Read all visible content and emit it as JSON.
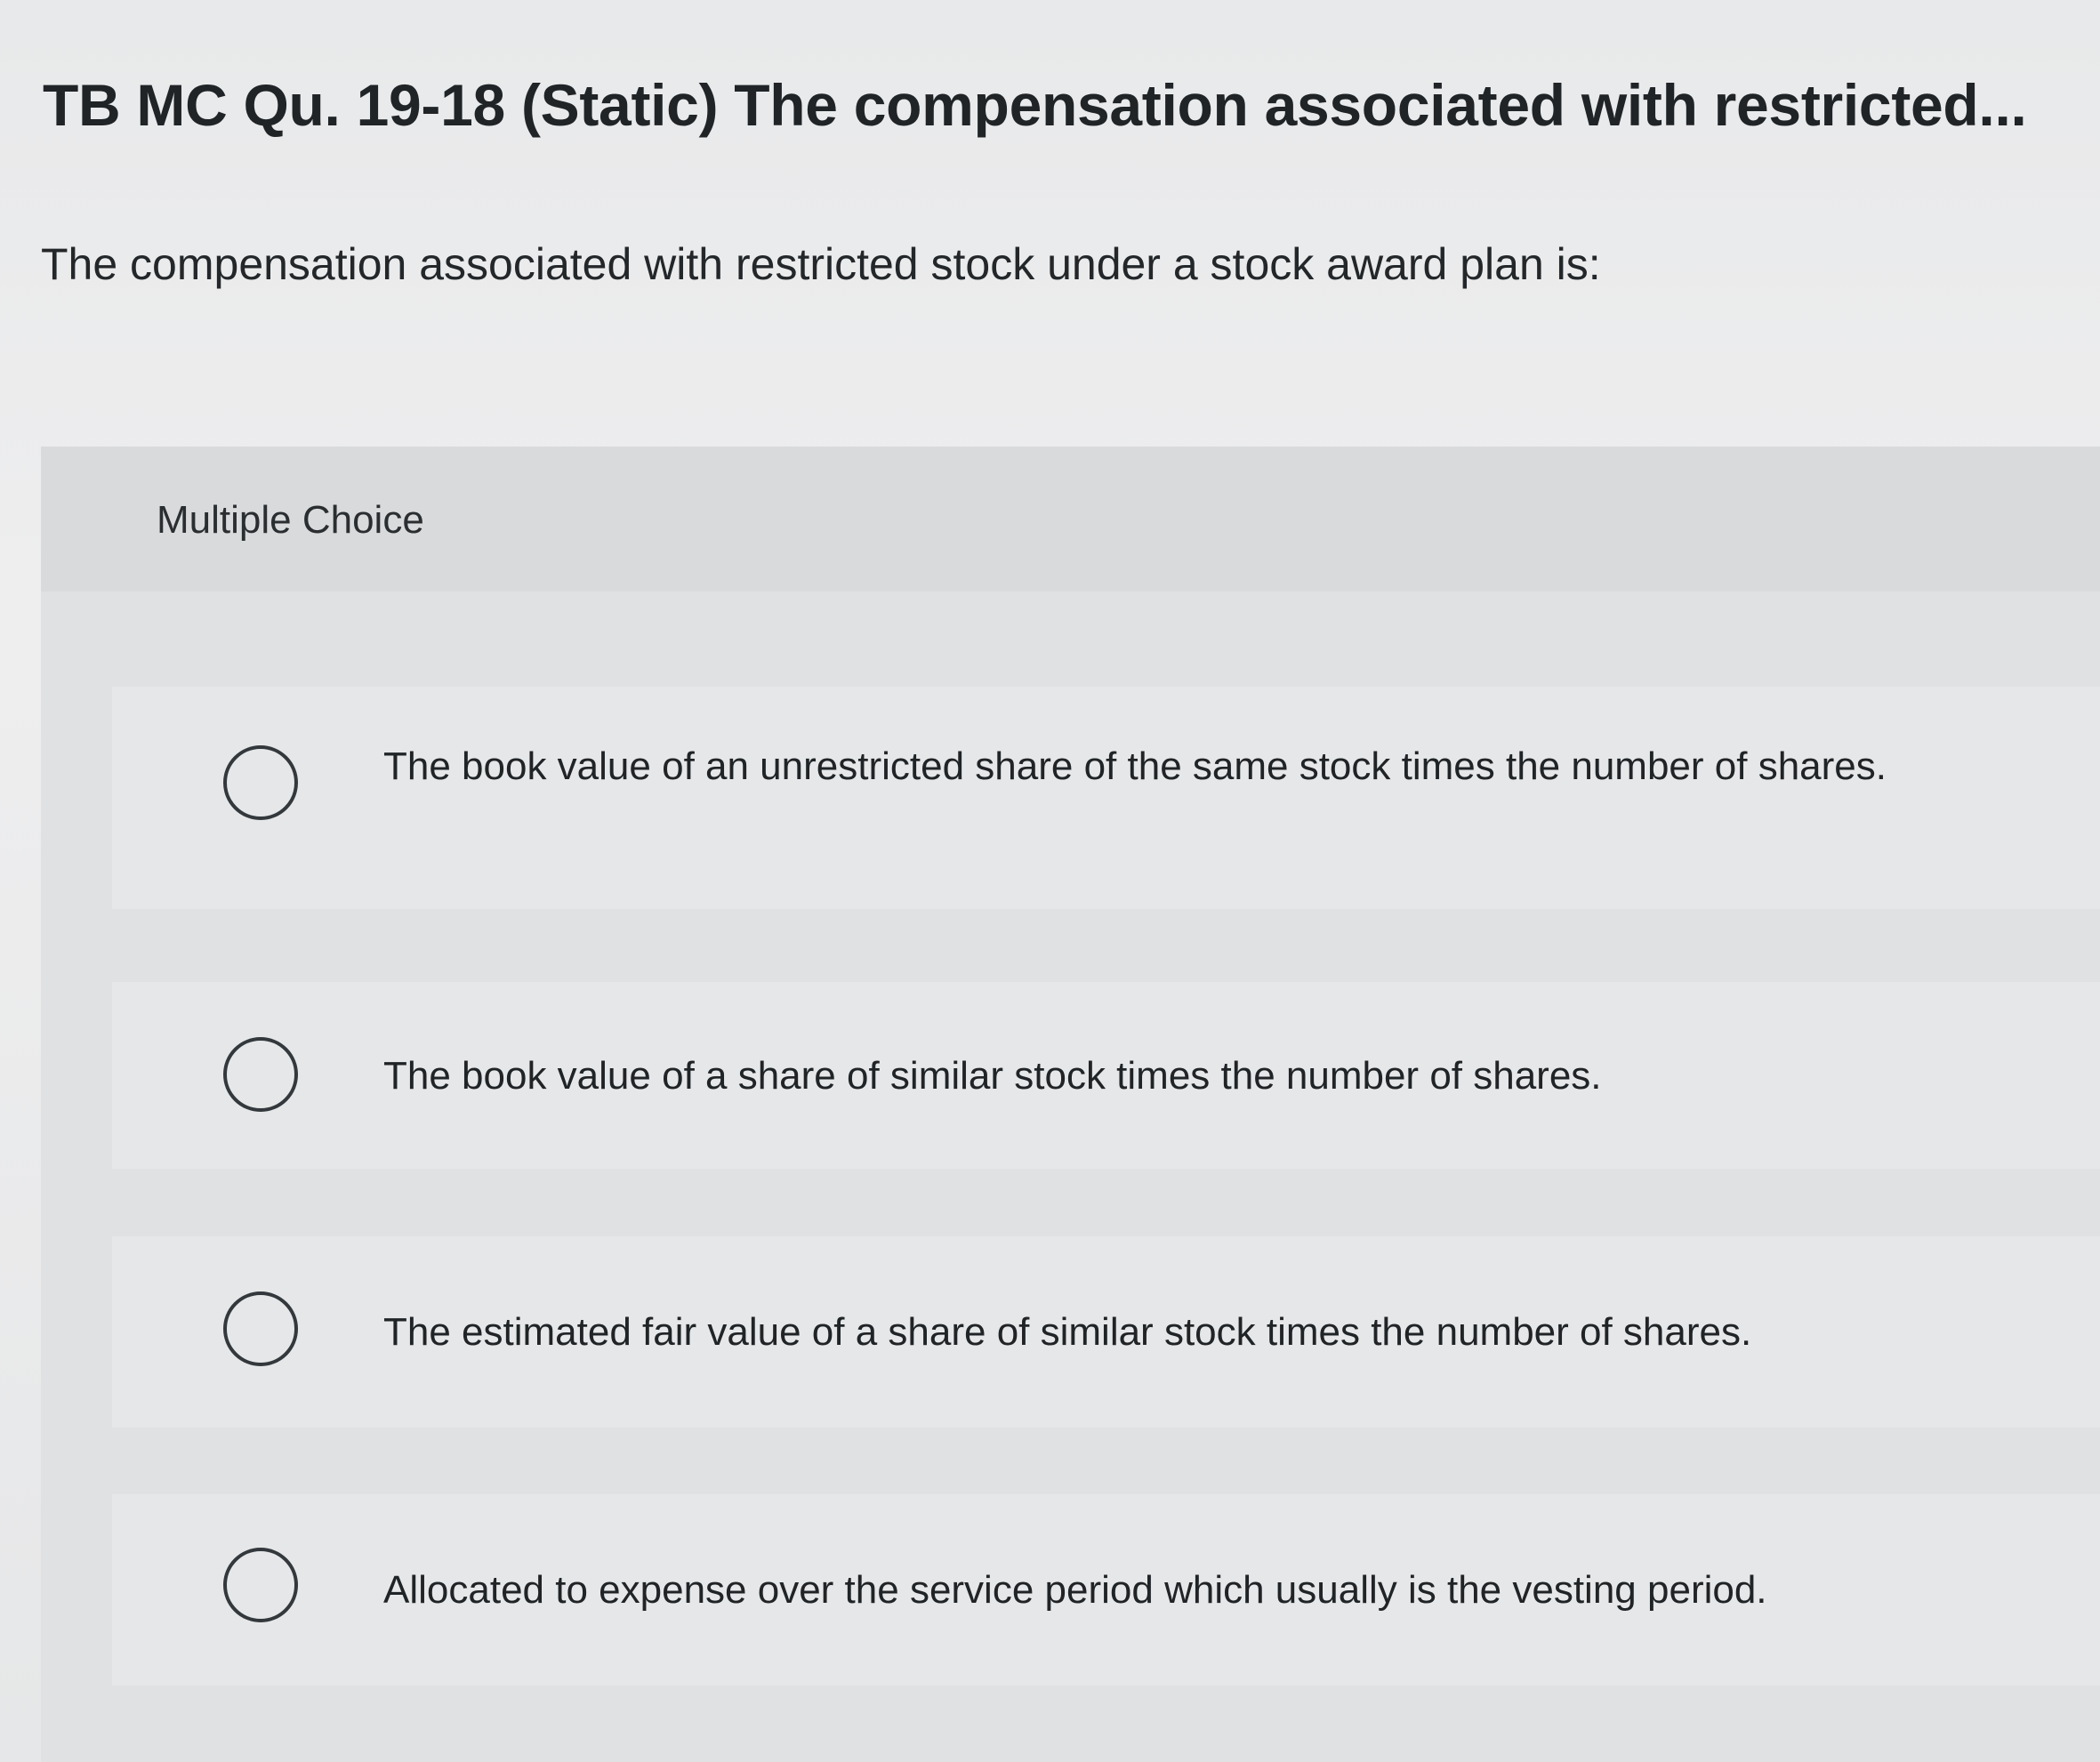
{
  "header": {
    "title": "TB MC Qu. 19-18 (Static) The compensation associated with restricted..."
  },
  "question": {
    "text": "The compensation associated with restricted stock under a stock award plan is:"
  },
  "multiple_choice": {
    "label": "Multiple Choice",
    "options": [
      {
        "text": "The book value of an unrestricted share of the same stock times the number of shares.",
        "selected": false
      },
      {
        "text": "The book value of a share of similar stock times the number of shares.",
        "selected": false
      },
      {
        "text": "The estimated fair value of a share of similar stock times the number of shares.",
        "selected": false
      },
      {
        "text": "Allocated to expense over the service period which usually is the vesting period.",
        "selected": false
      }
    ]
  }
}
